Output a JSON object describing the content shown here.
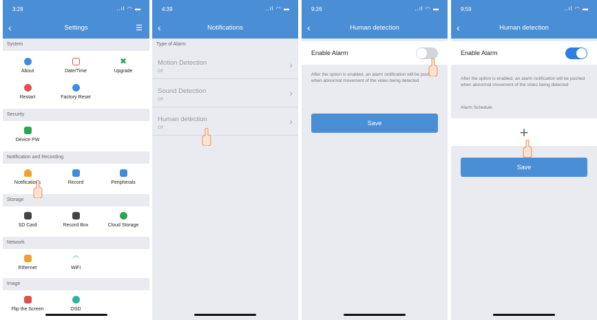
{
  "phone1": {
    "status_time": "3:28",
    "status_signal": "‥ıl ◠ ▬",
    "title": "Settings",
    "sections": {
      "system": "System",
      "security": "Security",
      "notification": "Notification and Recording",
      "storage": "Storage",
      "network": "Network",
      "image": "Image"
    },
    "items": {
      "about": "About",
      "datetime": "Date/Time",
      "upgrade": "Upgrade",
      "restart": "Restart",
      "factory_reset": "Factory Reset",
      "device_pw": "Device PW",
      "notifications": "Notifications",
      "record": "Record",
      "peripherals": "Peripherals",
      "sd_card": "SD Card",
      "record_box": "Record Box",
      "cloud_storage": "Cloud Storage",
      "ethernet": "Ethernet",
      "wifi": "WiFi",
      "flip_screen": "Flip the Screen",
      "osd": "OSD"
    }
  },
  "phone2": {
    "status_time": "4:39",
    "status_signal": "‥ıl ◠ ▬",
    "title": "Notifications",
    "section": "Type of Alarm",
    "rows": [
      {
        "label": "Motion Detection",
        "status": "Off"
      },
      {
        "label": "Sound Detection",
        "status": "Off"
      },
      {
        "label": "Human detection",
        "status": "Off"
      }
    ]
  },
  "phone3": {
    "status_time": "9:26",
    "status_signal": "‥ıl ◠ ▬",
    "title": "Human detection",
    "enable_label": "Enable Alarm",
    "description": "After the option is enabled, an alarm notification will be pushed when abnormal movement of the video being detected",
    "save_label": "Save",
    "toggle_state": "off"
  },
  "phone4": {
    "status_time": "9:59",
    "status_signal": "‥ıl ◠ ▬",
    "title": "Human detection",
    "enable_label": "Enable Alarm",
    "description": "After the option is enabled, an alarm notification will be pushed when abnormal movement of the video being detected",
    "schedule_label": "Alarm Schedule",
    "add_symbol": "+",
    "save_label": "Save",
    "toggle_state": "on"
  },
  "colors": {
    "accent": "#4a8fd6",
    "toggle_off": "#d3d5da",
    "toggle_on": "#2f7de0"
  }
}
